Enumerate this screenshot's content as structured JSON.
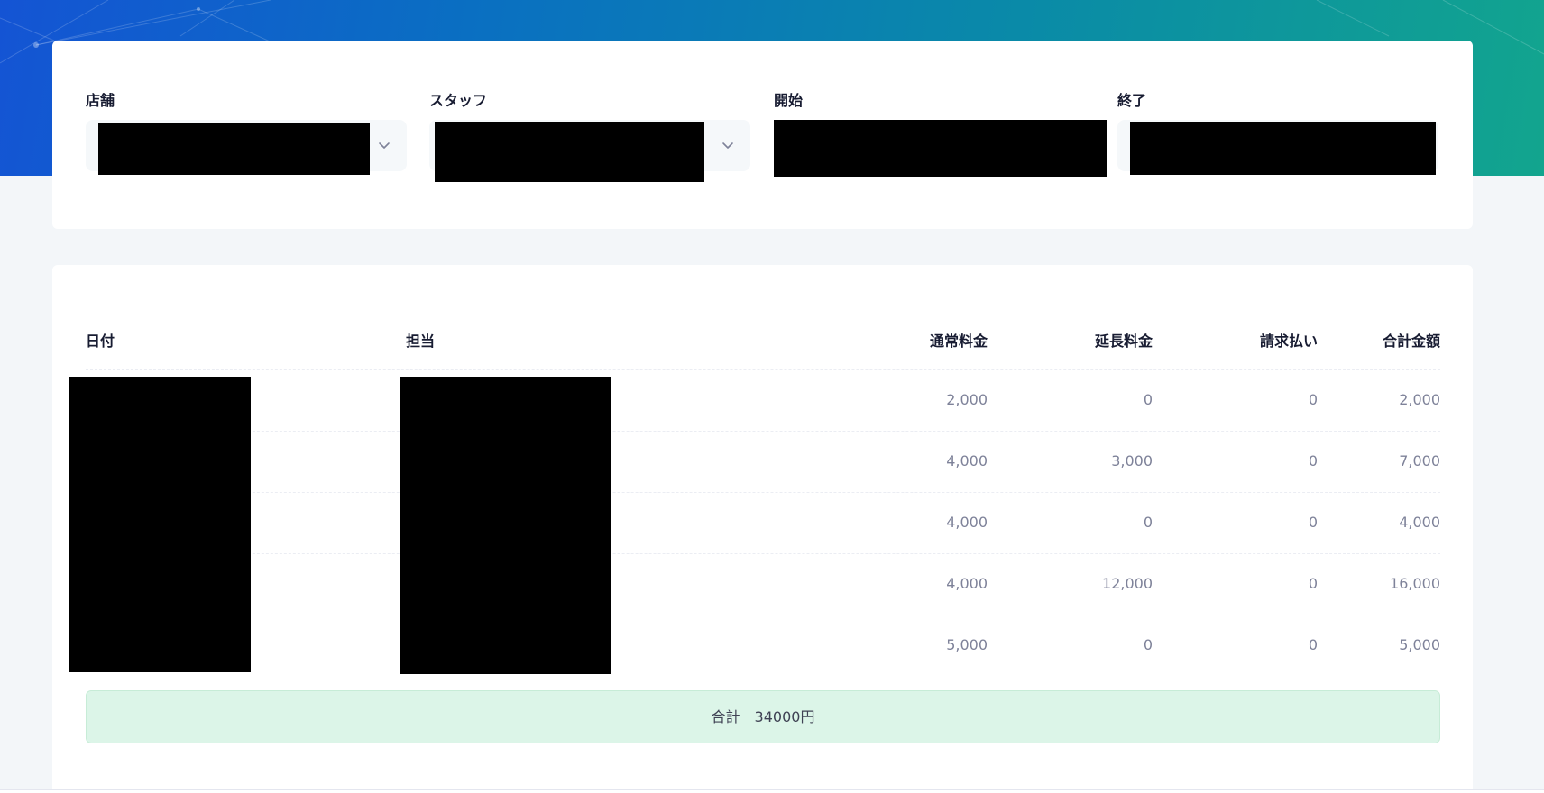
{
  "filters": {
    "store_label": "店舗",
    "staff_label": "スタッフ",
    "start_label": "開始",
    "end_label": "終了"
  },
  "table": {
    "headers": {
      "date": "日付",
      "staff": "担当",
      "regular": "通常料金",
      "extension": "延長料金",
      "invoice": "請求払い",
      "total": "合計金額"
    },
    "rows": [
      {
        "regular": "2,000",
        "extension": "0",
        "invoice": "0",
        "total": "2,000"
      },
      {
        "regular": "4,000",
        "extension": "3,000",
        "invoice": "0",
        "total": "7,000"
      },
      {
        "regular": "4,000",
        "extension": "0",
        "invoice": "0",
        "total": "4,000"
      },
      {
        "regular": "4,000",
        "extension": "12,000",
        "invoice": "0",
        "total": "16,000"
      },
      {
        "regular": "5,000",
        "extension": "0",
        "invoice": "0",
        "total": "5,000"
      }
    ]
  },
  "summary": {
    "total_text": "合計　34000円"
  },
  "icons": {
    "dropdown": "chevron-down-icon"
  },
  "colors": {
    "summary_bg": "#dcf5e8",
    "hero_start": "#1454d4",
    "hero_end": "#12a58e"
  }
}
